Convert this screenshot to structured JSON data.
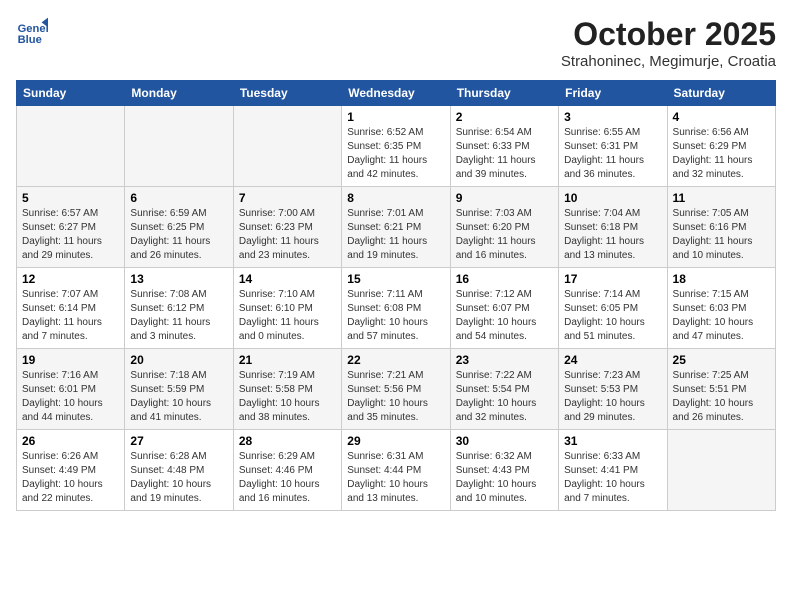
{
  "header": {
    "logo_line1": "General",
    "logo_line2": "Blue",
    "title": "October 2025",
    "subtitle": "Strahoninec, Megimurje, Croatia"
  },
  "calendar": {
    "headers": [
      "Sunday",
      "Monday",
      "Tuesday",
      "Wednesday",
      "Thursday",
      "Friday",
      "Saturday"
    ],
    "weeks": [
      [
        {
          "day": "",
          "info": ""
        },
        {
          "day": "",
          "info": ""
        },
        {
          "day": "",
          "info": ""
        },
        {
          "day": "1",
          "info": "Sunrise: 6:52 AM\nSunset: 6:35 PM\nDaylight: 11 hours\nand 42 minutes."
        },
        {
          "day": "2",
          "info": "Sunrise: 6:54 AM\nSunset: 6:33 PM\nDaylight: 11 hours\nand 39 minutes."
        },
        {
          "day": "3",
          "info": "Sunrise: 6:55 AM\nSunset: 6:31 PM\nDaylight: 11 hours\nand 36 minutes."
        },
        {
          "day": "4",
          "info": "Sunrise: 6:56 AM\nSunset: 6:29 PM\nDaylight: 11 hours\nand 32 minutes."
        }
      ],
      [
        {
          "day": "5",
          "info": "Sunrise: 6:57 AM\nSunset: 6:27 PM\nDaylight: 11 hours\nand 29 minutes."
        },
        {
          "day": "6",
          "info": "Sunrise: 6:59 AM\nSunset: 6:25 PM\nDaylight: 11 hours\nand 26 minutes."
        },
        {
          "day": "7",
          "info": "Sunrise: 7:00 AM\nSunset: 6:23 PM\nDaylight: 11 hours\nand 23 minutes."
        },
        {
          "day": "8",
          "info": "Sunrise: 7:01 AM\nSunset: 6:21 PM\nDaylight: 11 hours\nand 19 minutes."
        },
        {
          "day": "9",
          "info": "Sunrise: 7:03 AM\nSunset: 6:20 PM\nDaylight: 11 hours\nand 16 minutes."
        },
        {
          "day": "10",
          "info": "Sunrise: 7:04 AM\nSunset: 6:18 PM\nDaylight: 11 hours\nand 13 minutes."
        },
        {
          "day": "11",
          "info": "Sunrise: 7:05 AM\nSunset: 6:16 PM\nDaylight: 11 hours\nand 10 minutes."
        }
      ],
      [
        {
          "day": "12",
          "info": "Sunrise: 7:07 AM\nSunset: 6:14 PM\nDaylight: 11 hours\nand 7 minutes."
        },
        {
          "day": "13",
          "info": "Sunrise: 7:08 AM\nSunset: 6:12 PM\nDaylight: 11 hours\nand 3 minutes."
        },
        {
          "day": "14",
          "info": "Sunrise: 7:10 AM\nSunset: 6:10 PM\nDaylight: 11 hours\nand 0 minutes."
        },
        {
          "day": "15",
          "info": "Sunrise: 7:11 AM\nSunset: 6:08 PM\nDaylight: 10 hours\nand 57 minutes."
        },
        {
          "day": "16",
          "info": "Sunrise: 7:12 AM\nSunset: 6:07 PM\nDaylight: 10 hours\nand 54 minutes."
        },
        {
          "day": "17",
          "info": "Sunrise: 7:14 AM\nSunset: 6:05 PM\nDaylight: 10 hours\nand 51 minutes."
        },
        {
          "day": "18",
          "info": "Sunrise: 7:15 AM\nSunset: 6:03 PM\nDaylight: 10 hours\nand 47 minutes."
        }
      ],
      [
        {
          "day": "19",
          "info": "Sunrise: 7:16 AM\nSunset: 6:01 PM\nDaylight: 10 hours\nand 44 minutes."
        },
        {
          "day": "20",
          "info": "Sunrise: 7:18 AM\nSunset: 5:59 PM\nDaylight: 10 hours\nand 41 minutes."
        },
        {
          "day": "21",
          "info": "Sunrise: 7:19 AM\nSunset: 5:58 PM\nDaylight: 10 hours\nand 38 minutes."
        },
        {
          "day": "22",
          "info": "Sunrise: 7:21 AM\nSunset: 5:56 PM\nDaylight: 10 hours\nand 35 minutes."
        },
        {
          "day": "23",
          "info": "Sunrise: 7:22 AM\nSunset: 5:54 PM\nDaylight: 10 hours\nand 32 minutes."
        },
        {
          "day": "24",
          "info": "Sunrise: 7:23 AM\nSunset: 5:53 PM\nDaylight: 10 hours\nand 29 minutes."
        },
        {
          "day": "25",
          "info": "Sunrise: 7:25 AM\nSunset: 5:51 PM\nDaylight: 10 hours\nand 26 minutes."
        }
      ],
      [
        {
          "day": "26",
          "info": "Sunrise: 6:26 AM\nSunset: 4:49 PM\nDaylight: 10 hours\nand 22 minutes."
        },
        {
          "day": "27",
          "info": "Sunrise: 6:28 AM\nSunset: 4:48 PM\nDaylight: 10 hours\nand 19 minutes."
        },
        {
          "day": "28",
          "info": "Sunrise: 6:29 AM\nSunset: 4:46 PM\nDaylight: 10 hours\nand 16 minutes."
        },
        {
          "day": "29",
          "info": "Sunrise: 6:31 AM\nSunset: 4:44 PM\nDaylight: 10 hours\nand 13 minutes."
        },
        {
          "day": "30",
          "info": "Sunrise: 6:32 AM\nSunset: 4:43 PM\nDaylight: 10 hours\nand 10 minutes."
        },
        {
          "day": "31",
          "info": "Sunrise: 6:33 AM\nSunset: 4:41 PM\nDaylight: 10 hours\nand 7 minutes."
        },
        {
          "day": "",
          "info": ""
        }
      ]
    ]
  }
}
